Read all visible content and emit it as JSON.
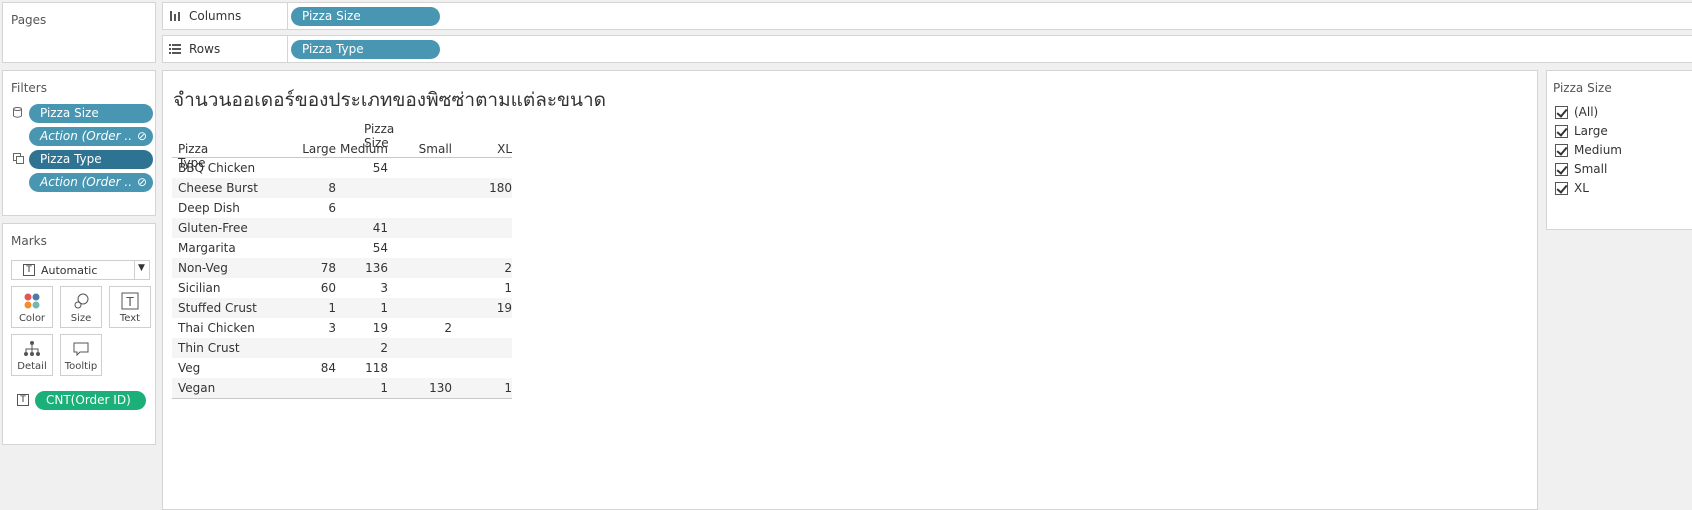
{
  "pages": {
    "title": "Pages"
  },
  "columns_shelf": {
    "label": "Columns",
    "pill": "Pizza Size"
  },
  "rows_shelf": {
    "label": "Rows",
    "pill": "Pizza Type"
  },
  "filters": {
    "title": "Filters",
    "items": [
      {
        "label": "Pizza Size",
        "style": "blue"
      },
      {
        "label": "Action (Order ..",
        "style": "italic"
      },
      {
        "label": "Pizza Type",
        "style": "dark"
      },
      {
        "label": "Action (Order ..",
        "style": "italic"
      }
    ]
  },
  "marks": {
    "title": "Marks",
    "type_select": "Automatic",
    "buttons": [
      "Color",
      "Size",
      "Text",
      "Detail",
      "Tooltip"
    ],
    "field_pill": "CNT(Order ID)"
  },
  "view": {
    "title": "จำนวนออเดอร์ของประเภทของพิซซ่าตามแต่ละขนาด",
    "column_group_header": "Pizza Size",
    "row_header": "Pizza Type",
    "columns": [
      "Large",
      "Medium",
      "Small",
      "XL"
    ],
    "rows": [
      {
        "name": "BBQ Chicken",
        "values": [
          "",
          "54",
          "",
          ""
        ]
      },
      {
        "name": "Cheese Burst",
        "values": [
          "8",
          "",
          "",
          "180"
        ]
      },
      {
        "name": "Deep Dish",
        "values": [
          "6",
          "",
          "",
          ""
        ]
      },
      {
        "name": "Gluten-Free",
        "values": [
          "",
          "41",
          "",
          ""
        ]
      },
      {
        "name": "Margarita",
        "values": [
          "",
          "54",
          "",
          ""
        ]
      },
      {
        "name": "Non-Veg",
        "values": [
          "78",
          "136",
          "",
          "2"
        ]
      },
      {
        "name": "Sicilian",
        "values": [
          "60",
          "3",
          "",
          "1"
        ]
      },
      {
        "name": "Stuffed Crust",
        "values": [
          "1",
          "1",
          "",
          "19"
        ]
      },
      {
        "name": "Thai Chicken",
        "values": [
          "3",
          "19",
          "2",
          ""
        ]
      },
      {
        "name": "Thin Crust",
        "values": [
          "",
          "2",
          "",
          ""
        ]
      },
      {
        "name": "Veg",
        "values": [
          "84",
          "118",
          "",
          ""
        ]
      },
      {
        "name": "Vegan",
        "values": [
          "",
          "1",
          "130",
          "1"
        ]
      }
    ]
  },
  "size_filter": {
    "title": "Pizza Size",
    "options": [
      "(All)",
      "Large",
      "Medium",
      "Small",
      "XL"
    ]
  },
  "colors": {
    "pill_blue": "#4996b2",
    "pill_dark": "#2f7393",
    "pill_green": "#1bb07a"
  }
}
